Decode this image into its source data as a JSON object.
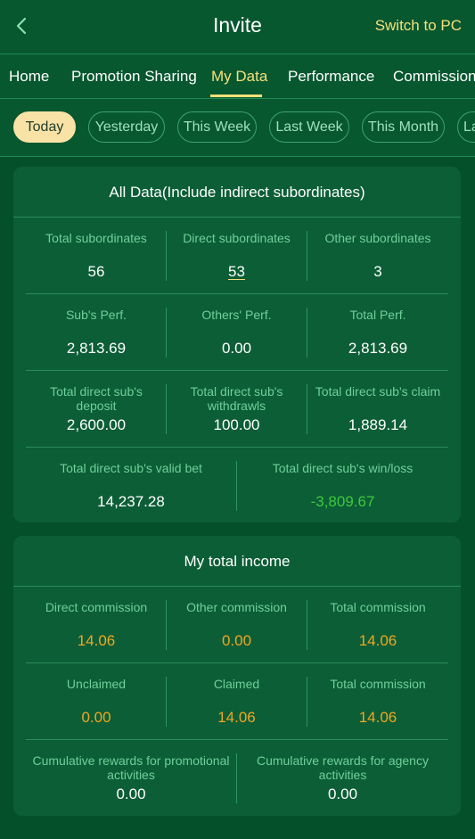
{
  "header": {
    "title": "Invite",
    "switch_label": "Switch to PC"
  },
  "nav": {
    "items": [
      {
        "label": "Home"
      },
      {
        "label": "Promotion Sharing"
      },
      {
        "label": "My Data"
      },
      {
        "label": "Performance"
      },
      {
        "label": "Commission"
      }
    ],
    "active": "My Data"
  },
  "periods": {
    "items": [
      {
        "label": "Today"
      },
      {
        "label": "Yesterday"
      },
      {
        "label": "This Week"
      },
      {
        "label": "Last Week"
      },
      {
        "label": "This Month"
      },
      {
        "label": "La"
      }
    ],
    "active": "Today"
  },
  "all_data": {
    "title": "All Data(Include indirect subordinates)",
    "total_subordinates": {
      "label": "Total subordinates",
      "value": "56"
    },
    "direct_subordinates": {
      "label": "Direct subordinates",
      "value": "53"
    },
    "other_subordinates": {
      "label": "Other subordinates",
      "value": "3"
    },
    "subs_perf": {
      "label": "Sub's Perf.",
      "value": "2,813.69"
    },
    "others_perf": {
      "label": "Others' Perf.",
      "value": "0.00"
    },
    "total_perf": {
      "label": "Total Perf.",
      "value": "2,813.69"
    },
    "direct_deposit": {
      "label_line1": "Total direct sub's",
      "label_line2": "deposit",
      "value": "2,600.00"
    },
    "direct_withdrawls": {
      "label_line1": "Total direct sub's",
      "label_line2": "withdrawls",
      "value": "100.00"
    },
    "direct_claim": {
      "label": "Total direct sub's claim",
      "value": "1,889.14"
    },
    "direct_valid_bet": {
      "label": "Total direct sub's valid bet",
      "value": "14,237.28"
    },
    "direct_winloss": {
      "label": "Total direct sub's win/loss",
      "value": "-3,809.67"
    }
  },
  "income": {
    "title": "My total income",
    "direct_commission": {
      "label": "Direct commission",
      "value": "14.06"
    },
    "other_commission": {
      "label": "Other commission",
      "value": "0.00"
    },
    "total_commission_1": {
      "label": "Total commission",
      "value": "14.06"
    },
    "unclaimed": {
      "label": "Unclaimed",
      "value": "0.00"
    },
    "claimed": {
      "label": "Claimed",
      "value": "14.06"
    },
    "total_commission_2": {
      "label": "Total commission",
      "value": "14.06"
    },
    "promo_rewards": {
      "label_line1": "Cumulative rewards for promotional",
      "label_line2": "activities",
      "value": "0.00"
    },
    "agency_rewards": {
      "label_line1": "Cumulative rewards for agency",
      "label_line2": "activities",
      "value": "0.00"
    }
  },
  "colors": {
    "background": "#04502a",
    "card": "#0c5e36",
    "accent_gold": "#f4e07a",
    "money_orange": "#f0a623",
    "negative_green": "#3ec83e",
    "label_green": "#6fd09a"
  }
}
